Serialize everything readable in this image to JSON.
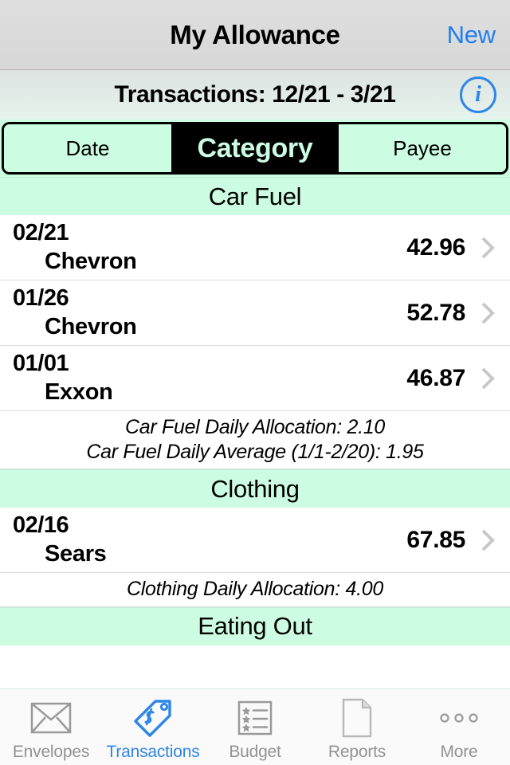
{
  "navbar": {
    "title": "My Allowance",
    "new_label": "New",
    "new_color": "#1f7ff0"
  },
  "subheader": {
    "title": "Transactions: 12/21 - 3/21",
    "info_icon": "info-circle-icon",
    "info_glyph": "i",
    "info_color": "#2d86e8"
  },
  "segmented_control": {
    "selected": "Category",
    "segments": [
      {
        "label": "Date",
        "selected": false
      },
      {
        "label": "Category",
        "selected": true
      },
      {
        "label": "Payee",
        "selected": false
      }
    ],
    "accent_bg": "#ccfce2",
    "selected_bg": "#000000"
  },
  "sections": [
    {
      "title": "Car Fuel",
      "transactions": [
        {
          "date": "02/21",
          "payee": "Chevron",
          "amount": "42.96"
        },
        {
          "date": "01/26",
          "payee": "Chevron",
          "amount": "52.78"
        },
        {
          "date": "01/01",
          "payee": "Exxon",
          "amount": "46.87"
        }
      ],
      "footnotes": [
        "Car Fuel Daily Allocation:  2.10",
        "Car Fuel Daily Average (1/1-2/20):   1.95"
      ]
    },
    {
      "title": "Clothing",
      "transactions": [
        {
          "date": "02/16",
          "payee": "Sears",
          "amount": "67.85"
        }
      ],
      "footnotes": [
        "Clothing Daily Allocation:  4.00"
      ]
    },
    {
      "title": "Eating Out",
      "transactions": [],
      "footnotes": []
    }
  ],
  "tabbar": {
    "items": [
      {
        "label": "Envelopes",
        "icon": "envelope-icon",
        "active": false
      },
      {
        "label": "Transactions",
        "icon": "price-tag-icon",
        "active": true
      },
      {
        "label": "Budget",
        "icon": "checklist-icon",
        "active": false
      },
      {
        "label": "Reports",
        "icon": "document-icon",
        "active": false
      },
      {
        "label": "More",
        "icon": "ellipsis-icon",
        "active": false
      }
    ],
    "active_color": "#2d86e8",
    "inactive_color": "#929292"
  }
}
